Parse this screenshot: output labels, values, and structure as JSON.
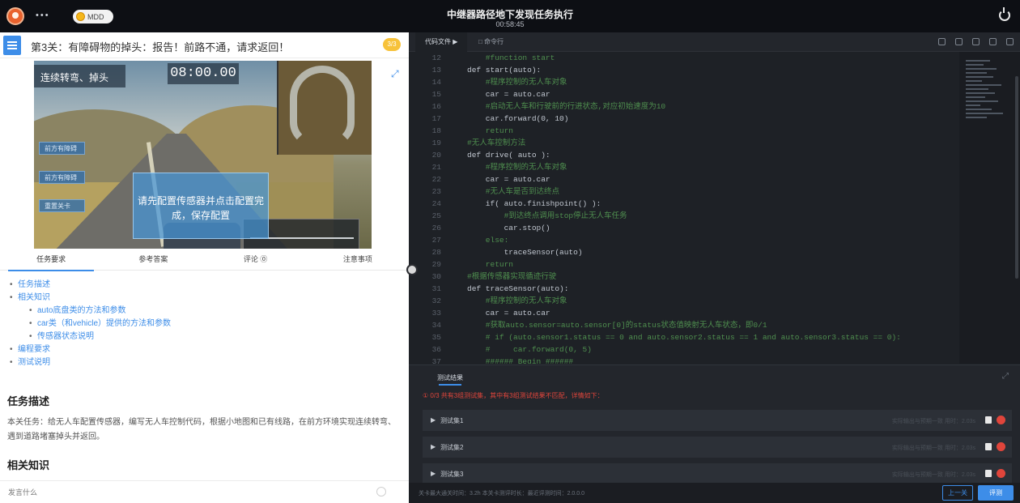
{
  "topbar": {
    "user_name": "•••",
    "coins": "MDD",
    "title": "中继器路径地下发现任务执行",
    "subtitle": "00:58:45"
  },
  "left": {
    "level_title": "第3关：有障碍物的掉头：报告！前路不通，请求返回！",
    "level_badge": "3/3",
    "scene": {
      "chip": "连续转弯、掉头",
      "timer": "08:00.00",
      "side_buttons": [
        "前方有障碍",
        "前方有障碍",
        "重置关卡"
      ],
      "modal_text": "请先配置传感器并点击配置完成，保存配置"
    },
    "tabs": [
      "任务要求",
      "参考答案",
      "评论 ⓪",
      "注意事项"
    ],
    "toc": {
      "items": [
        "任务描述",
        "相关知识",
        "编程要求",
        "测试说明"
      ],
      "sub": [
        "auto底盘类的方法和参数",
        "car类（和vehicle）提供的方法和参数",
        "传感器状态说明"
      ]
    },
    "task_title": "任务描述",
    "task_desc": "本关任务：给无人车配置传感器，编写无人车控制代码，根据小地图和已有线路，在前方环境实现连续转弯、遇到道路堵塞掉头并返回。",
    "knowledge_title": "相关知识",
    "chat_placeholder": "发言什么"
  },
  "editor": {
    "tabs": [
      "代码文件 ▶",
      "□ 命令行"
    ],
    "lines": [
      {
        "n": "12",
        "t": "    #function start",
        "c": "cm"
      },
      {
        "n": "13",
        "t": "def start(auto):",
        "c": "kw"
      },
      {
        "n": "14",
        "t": "    #程序控制的无人车对象",
        "c": "cm"
      },
      {
        "n": "15",
        "t": "    car = auto.car",
        "c": "kw"
      },
      {
        "n": "16",
        "t": "    #启动无人车和行驶前的行进状态,对应初始速度为10",
        "c": "cm"
      },
      {
        "n": "17",
        "t": "    car.forward(0, 10)",
        "c": "kw"
      },
      {
        "n": "18",
        "t": "    return",
        "c": "cm"
      },
      {
        "n": "19",
        "t": "#无人车控制方法",
        "c": "cm"
      },
      {
        "n": "20",
        "t": "def drive( auto ):",
        "c": "kw"
      },
      {
        "n": "21",
        "t": "    #程序控制的无人车对象",
        "c": "cm"
      },
      {
        "n": "22",
        "t": "    car = auto.car",
        "c": "kw"
      },
      {
        "n": "23",
        "t": "    #无人车是否到达终点",
        "c": "cm"
      },
      {
        "n": "24",
        "t": "    if( auto.finishpoint() ):",
        "c": "kw"
      },
      {
        "n": "25",
        "t": "        #到达终点调用stop停止无人车任务",
        "c": "cm"
      },
      {
        "n": "26",
        "t": "        car.stop()",
        "c": "kw"
      },
      {
        "n": "27",
        "t": "    else:",
        "c": "cm"
      },
      {
        "n": "28",
        "t": "        traceSensor(auto)",
        "c": "kw"
      },
      {
        "n": "29",
        "t": "    return",
        "c": "cm"
      },
      {
        "n": "30",
        "t": "#根据传感器实现循迹行驶",
        "c": "cm"
      },
      {
        "n": "31",
        "t": "def traceSensor(auto):",
        "c": "kw"
      },
      {
        "n": "32",
        "t": "    #程序控制的无人车对象",
        "c": "cm"
      },
      {
        "n": "33",
        "t": "    car = auto.car",
        "c": "kw"
      },
      {
        "n": "34",
        "t": "    #获取auto.sensor=auto.sensor[0]的status状态值映射无人车状态，即0/1",
        "c": "cm"
      },
      {
        "n": "35",
        "t": "    # if (auto.sensor1.status == 0 and auto.sensor2.status == 1 and auto.sensor3.status == 0):",
        "c": "cm"
      },
      {
        "n": "36",
        "t": "    #     car.forward(0, 5)",
        "c": "cm"
      },
      {
        "n": "37",
        "t": "    ###### Begin ######",
        "c": "cm"
      },
      {
        "n": "38",
        "t": "    if(auto.sensor1.status == 0 and auto.sensor2.status == 1 and auto.sensor3.status == 0 and auto.sens",
        "c": "kw"
      }
    ],
    "result_tab": "测试结果",
    "result_message": "① 0/3  共有3组测试集，其中有3组测试结果不匹配，详情如下：",
    "tests": [
      {
        "name": "测试集1",
        "meta": "实际输出与预期一致  用时：2.03s"
      },
      {
        "name": "测试集2",
        "meta": "实际输出与预期一致  用时：2.03s"
      },
      {
        "name": "测试集3",
        "meta": "实际输出与预期一致  用时：2.03s"
      }
    ],
    "footer_note": "关卡最大通关时间：3.2h    本关卡测评时长：最近评测时间：2.0.0.0",
    "prev_label": "上一关",
    "submit_label": "评测"
  }
}
